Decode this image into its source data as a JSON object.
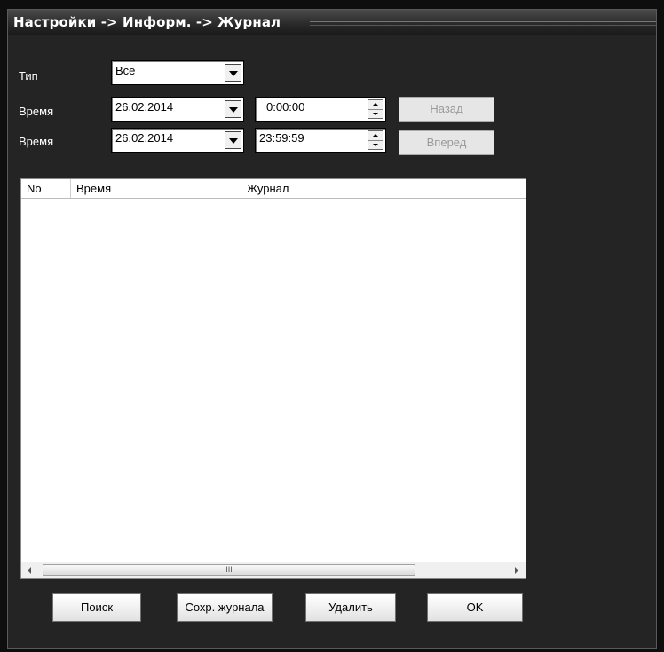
{
  "window": {
    "title": "Настройки -> Информ. -> Журнал"
  },
  "filters": {
    "type_label": "Тип",
    "type_value": "Все",
    "time_label_1": "Время",
    "date_from": "26.02.2014",
    "time_from": "0:00:00",
    "time_label_2": "Время",
    "date_to": "26.02.2014",
    "time_to": "23:59:59",
    "back_label": "Назад",
    "forward_label": "Вперед"
  },
  "table": {
    "columns": [
      "No",
      "Время",
      "Журнал"
    ],
    "rows": [],
    "scroll_thumb_glyph": "III"
  },
  "buttons": {
    "search": "Поиск",
    "save_log": "Сохр. журнала",
    "delete": "Удалить",
    "ok": "OK"
  },
  "icons": {
    "dropdown": "chevron-down-icon",
    "spin": "spin-updown-icon",
    "scroll_left": "arrow-left-icon",
    "scroll_right": "arrow-right-icon"
  },
  "colors": {
    "window_bg": "#242424",
    "titlebar": "#2b2b2b",
    "disabled_text": "#9a9a9a"
  }
}
